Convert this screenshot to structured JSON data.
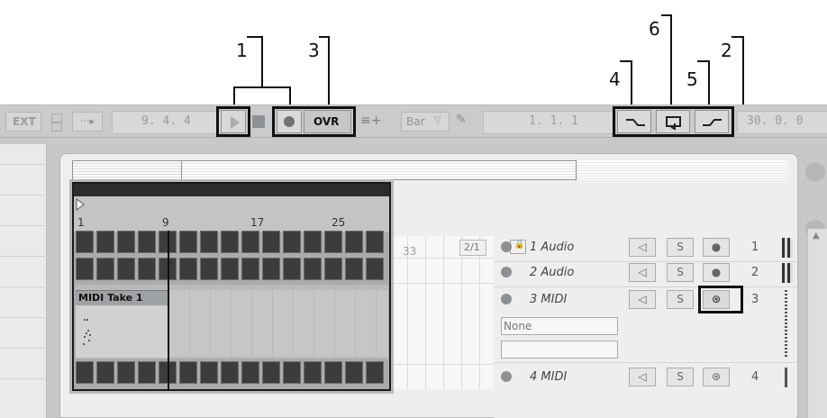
{
  "callouts": [
    "1",
    "2",
    "3",
    "4",
    "5",
    "6"
  ],
  "control_bar": {
    "ext_label": "EXT",
    "arrangement_position": "9.  4.  4",
    "record_mode_label": "OVR",
    "quantize_value": "Bar",
    "loop_position": "1.  1.  1",
    "loop_length": "30.  0.  0"
  },
  "overview": {
    "clip_title": "MIDI Take 1"
  },
  "ruler": {
    "marks": [
      "1",
      "9",
      "17",
      "25",
      "33"
    ],
    "zoom_label": "2/1"
  },
  "tracks": [
    {
      "name": "1 Audio",
      "number": "1",
      "solo_label": "S"
    },
    {
      "name": "2 Audio",
      "number": "2",
      "solo_label": "S"
    },
    {
      "name": "3 MIDI",
      "number": "3",
      "solo_label": "S",
      "input_value": "None",
      "channel_value": ""
    },
    {
      "name": "4 MIDI",
      "number": "4",
      "solo_label": "S"
    }
  ],
  "icons": [
    "link-arrows-icon",
    "play-icon",
    "stop-icon",
    "record-icon",
    "back-to-arrangement-icon",
    "pencil-icon",
    "punch-in-icon",
    "loop-icon",
    "punch-out-icon",
    "lock-icon",
    "speaker-icon",
    "arm-icon",
    "midi-arm-icon",
    "view-toggle-icon"
  ]
}
